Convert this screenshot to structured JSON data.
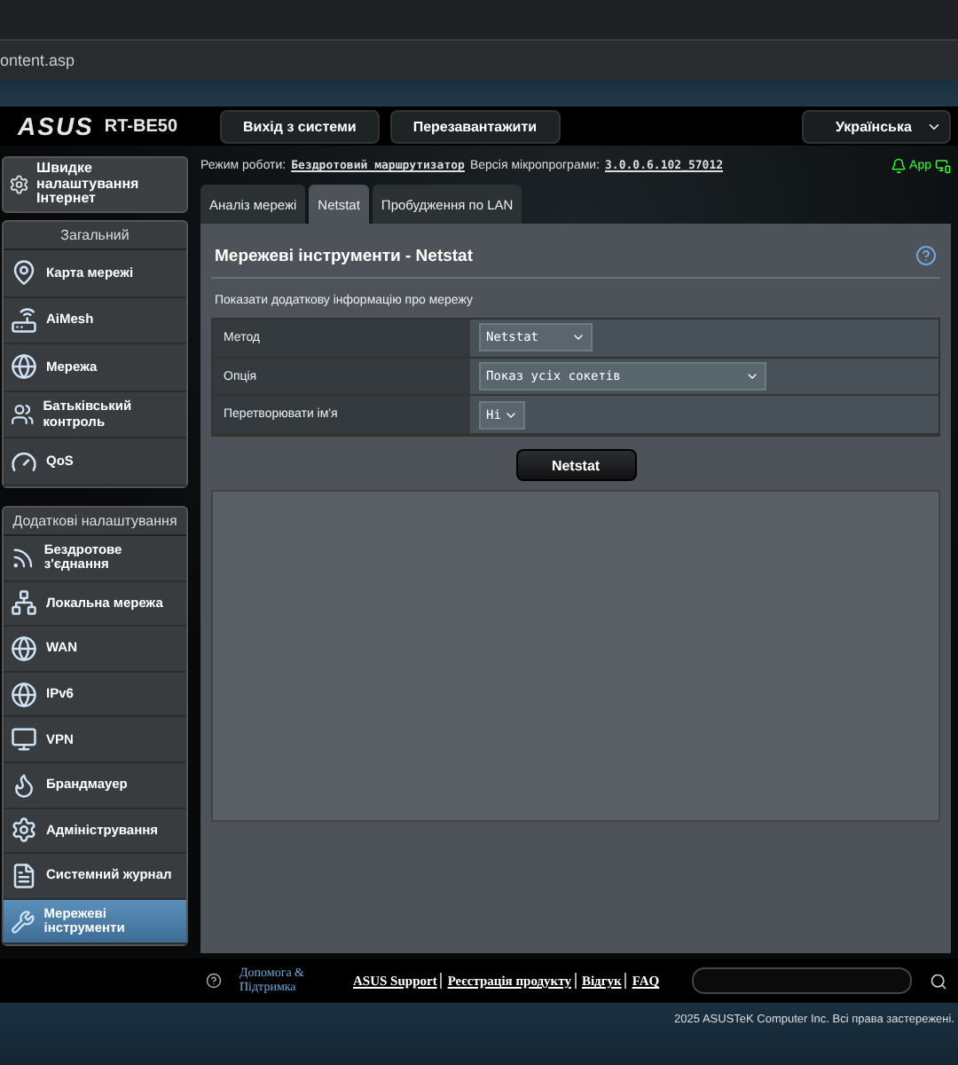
{
  "browser": {
    "address": "ontent.asp"
  },
  "header": {
    "logo": "ASUS",
    "model": "RT-BE50",
    "buttons": [
      "Вихід з системи",
      "Перезавантажити"
    ],
    "language": "Українська"
  },
  "status": {
    "mode_label": "Режим роботи:",
    "mode": "Бездротовий маршрутизатор",
    "firmware_label": "Версія мікропрограми:",
    "firmware": "3.0.0.6.102_57012",
    "app": "App"
  },
  "sidebar": {
    "quick": "Швидке налаштування Інтернет",
    "sections": [
      {
        "title": "Загальний",
        "items": [
          {
            "label": "Карта мережі",
            "selected": false
          },
          {
            "label": "AiMesh",
            "selected": false
          },
          {
            "label": "Мережа",
            "selected": false
          },
          {
            "label": "Батьківський контроль",
            "selected": false
          },
          {
            "label": "QoS",
            "selected": false
          }
        ]
      },
      {
        "title": "Додаткові налаштування",
        "items": [
          {
            "label": "Бездротове з'єднання",
            "selected": false
          },
          {
            "label": "Локальна мережа",
            "selected": false
          },
          {
            "label": "WAN",
            "selected": false
          },
          {
            "label": "IPv6",
            "selected": false
          },
          {
            "label": "VPN",
            "selected": false
          },
          {
            "label": "Брандмауер",
            "selected": false
          },
          {
            "label": "Адміністрування",
            "selected": false
          },
          {
            "label": "Системний журнал",
            "selected": false
          },
          {
            "label": "Мережеві інструменти",
            "selected": true
          }
        ]
      }
    ]
  },
  "tabs": [
    {
      "label": "Аналіз мережі",
      "selected": false
    },
    {
      "label": "Netstat",
      "selected": true
    },
    {
      "label": "Пробудження по LAN",
      "selected": false
    }
  ],
  "panel": {
    "title": "Мережеві інструменти - Netstat",
    "description": "Показати додаткову інформацію про мережу",
    "rows": [
      {
        "label": "Метод",
        "value": "Netstat"
      },
      {
        "label": "Опція",
        "value": "Показ усіх сокетів"
      },
      {
        "label": "Перетворювати ім'я",
        "value": "Ні"
      }
    ],
    "button": "Netstat"
  },
  "footer": {
    "help": "Допомога & Підтримка",
    "links": [
      "ASUS Support",
      "Реєстрація продукту",
      "Відгук",
      "FAQ"
    ],
    "copyright": "2025 ASUSTeK Computer Inc. Всі права застережені."
  }
}
